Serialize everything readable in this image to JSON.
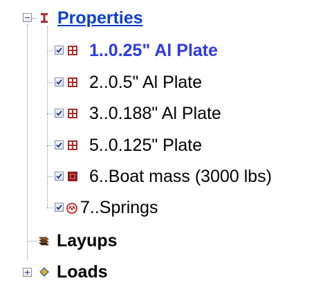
{
  "tree": {
    "properties": {
      "label": "Properties",
      "expanded": true,
      "icon": "beam-section-icon",
      "children": [
        {
          "label": "1..0.25\" Al Plate",
          "checked": true,
          "icon": "plate-grid-icon",
          "selected": true
        },
        {
          "label": "2..0.5\" Al Plate",
          "checked": true,
          "icon": "plate-grid-icon",
          "selected": false
        },
        {
          "label": "3..0.188\" Al Plate",
          "checked": true,
          "icon": "plate-grid-icon",
          "selected": false
        },
        {
          "label": "5..0.125\" Plate",
          "checked": true,
          "icon": "plate-grid-icon",
          "selected": false
        },
        {
          "label": "6..Boat mass (3000 lbs)",
          "checked": true,
          "icon": "mass-icon",
          "selected": false
        },
        {
          "label": "7..Springs",
          "checked": true,
          "icon": "spring-icon",
          "selected": false
        }
      ]
    },
    "layups": {
      "label": "Layups",
      "icon": "layup-stack-icon"
    },
    "loads": {
      "label": "Loads",
      "expanded": false,
      "icon": "load-icon"
    }
  },
  "colors": {
    "header_link": "#0b3fcf",
    "selected_text": "#2c39e6",
    "plate_icon": "#b02a2a",
    "spring_icon": "#d11c1c",
    "layup_icon": "#7a3d10",
    "load_icon": "#1a4fd6"
  }
}
